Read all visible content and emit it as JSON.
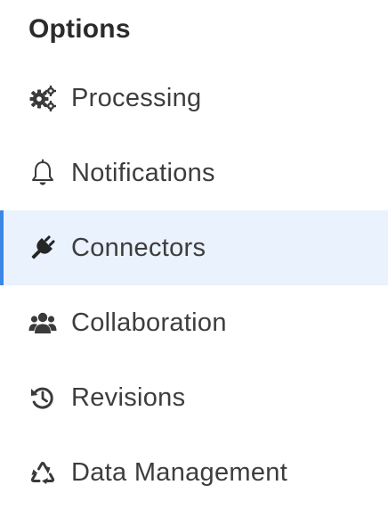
{
  "sidebar": {
    "title": "Options",
    "active_index": 2,
    "items": [
      {
        "label": "Processing",
        "icon": "cogs-icon"
      },
      {
        "label": "Notifications",
        "icon": "bell-icon"
      },
      {
        "label": "Connectors",
        "icon": "plug-icon"
      },
      {
        "label": "Collaboration",
        "icon": "users-icon"
      },
      {
        "label": "Revisions",
        "icon": "history-icon"
      },
      {
        "label": "Data Management",
        "icon": "recycle-icon"
      }
    ]
  },
  "colors": {
    "active_background": "#e9f2fd",
    "active_indicator": "#3b86e6",
    "text": "#3d3d3d"
  }
}
